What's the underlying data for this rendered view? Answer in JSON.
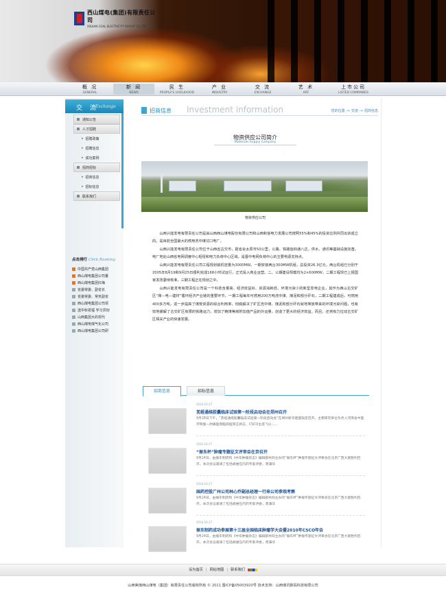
{
  "header": {
    "logo_cn": "西山煤电(集团)有限责任公司",
    "logo_en": "XISHAN COAL ELECTRICITY GROUP CO.,LTD.",
    "logo_tag": "山西焦煤"
  },
  "nav": [
    {
      "cn": "概 况",
      "en": "GENERAL"
    },
    {
      "cn": "新 闻",
      "en": "NEWS"
    },
    {
      "cn": "民 生",
      "en": "PEOPLE'S LIVELIHOOD"
    },
    {
      "cn": "产 业",
      "en": "INDUSTRY"
    },
    {
      "cn": "交 流",
      "en": "EXCHANGE"
    },
    {
      "cn": "艺 术",
      "en": "ART"
    },
    {
      "cn": "上市公司",
      "en": "LISTED COMPANIES"
    }
  ],
  "sidebar": {
    "title_cn": "交 流",
    "title_en": "Exchange",
    "menu": [
      {
        "label": "通知公告",
        "level": 1
      },
      {
        "label": "人才招聘",
        "level": 1
      },
      {
        "label": "招聘政策",
        "level": 2
      },
      {
        "label": "招聘信息",
        "level": 2
      },
      {
        "label": "成功案例",
        "level": 2
      },
      {
        "label": "招商招标",
        "level": 1
      },
      {
        "label": "招商信息",
        "level": 2
      },
      {
        "label": "招标信息",
        "level": 2
      },
      {
        "label": "联系我们",
        "level": 1
      }
    ],
    "ranking_title": "点击排行",
    "ranking_title_en": "Click Ranking",
    "ranking": [
      "中国共产党山西集团",
      "西山煤电集团公司董",
      "西山煤电集团红梅",
      "省委常委、副省长",
      "省委常委、常务副省",
      "西山煤电集团公司领",
      "送中秋祝福 学习贯彻",
      "山西集团大的现代",
      "西山煤电煤气化公司",
      "西山煤电集团公司研"
    ]
  },
  "main": {
    "section_cn": "招商信息",
    "section_en": "Investment information",
    "breadcrumb": "您的位置 -> 交流 -> 招商信息",
    "article_title": "物资供应公司简介",
    "article_subtitle": "Materials  Supply  Company",
    "photo_caption": "物资供应公司",
    "paragraphs": [
      "山西兴能发电有限责任公司是由山西西山煤电股份有限公司和山西和信电力发展公司按照55%和45%的投资比例共同出资成立的。是目前全国最大的燃用洗中煤坑口电厂。",
      "山西兴能发电有限责任公司位于山西省古交市，距省会太原市50公里，公路、铁路皆四通八达，供水、通讯等基础设施完善。电厂地处山西省电网调度中心枢纽和电力负荷中心区域，是晋中电网负荷中心的主要电源支持点。",
      "山西兴能发电有限责任公司工程规划装机容量为3000MW。一期安装两台300MW机组，总投资26.3亿元，两台机组已分别于2005年8月19和9月25日顺利完成168小时试运行，正式投入商业运营。二、三期建设规模均为2×600MW，二期工程现已上报国家发改委待核准，三期工程正在规划之中。",
      "山西兴能发电有限责任公司是一个科技含量高、经济效益好、资源消耗低、环境污染少的新型发电企业，其作为西山古交矿区“煤—电—建材”循环经济产业链的重要环节，一期工程每年可燃用200万吨洗中煤、煤泥和部分矸石，二期工程建成后，可燃用400多万吨，进一步提高了煤炭资源的综合利用率，彻底解决了矿区洗中煤、煤泥和部分矸石就地堆放带来的环境污染问题，也有效地缓解了古交矿区有限的铁路运力，增加了精煤等高附加值产品的外运量，创造了更大的经济效益。而且，还将有力拉动古交矿区相关产业的快速发展。"
    ],
    "tabs": [
      "招商信息",
      "招标信息"
    ],
    "news": [
      {
        "date": "2010-10-27",
        "title": "芪蛭通络胶囊临床试验第一阶段启动会在郑州召开",
        "desc": "9月28日下午，“芪蛭通络胶囊临床试验第一阶段启动会”在郑州新华建国饭店召开。主要研究单位负责人河南省中医学院第一附属医院脑病医院王新志、CSCO主席飞分……"
      },
      {
        "date": "2010-10-27",
        "title": "“振东杯”肿瘤专题征文评审会在京召开",
        "desc": "9月24日，由振东制药和《中华肿瘤杂志》编辑部共同主办的“振东杯”肿瘤专题征文评审会在北京广西大厦胜利召开。本次会议邀请了包括胡君在内的专家评委，周满华"
      },
      {
        "date": "2010-10-27",
        "title": "国药控股广州公司林心乔副总经理一行来公司参观考察",
        "desc": "9月24日，由振东制药和《中华肿瘤杂志》编辑部共同主办的“振东杯”肿瘤专题征文评审会在北京广西大厦胜利召开。本次会议邀请了包括胡君在内的专家评委，周满华"
      },
      {
        "date": "2010-10-27",
        "title": "振东制药成功参展第十三届全国临床肿瘤学大会暨2010年CSCO年会",
        "desc": "9月24日，由振东制药和《中华肿瘤杂志》编辑部共同主办的“振东杯”肿瘤专题征文评审会在北京广西大厦胜利召开。本次会议邀请了包括胡君在内的专家评委，周满华"
      }
    ]
  },
  "footer": {
    "links": [
      "设为首页",
      "网站地图",
      "联系我们"
    ],
    "copyright": "山西焦煤西山煤电（集团）有限责任公司版权所有  © 2011    晋ICP备05003920号    技术支持：山西博讯数码科技有限公司"
  },
  "colors": {
    "accent": "#3aa6d2",
    "link": "#1c4f8f",
    "fire": "#f08a18"
  }
}
